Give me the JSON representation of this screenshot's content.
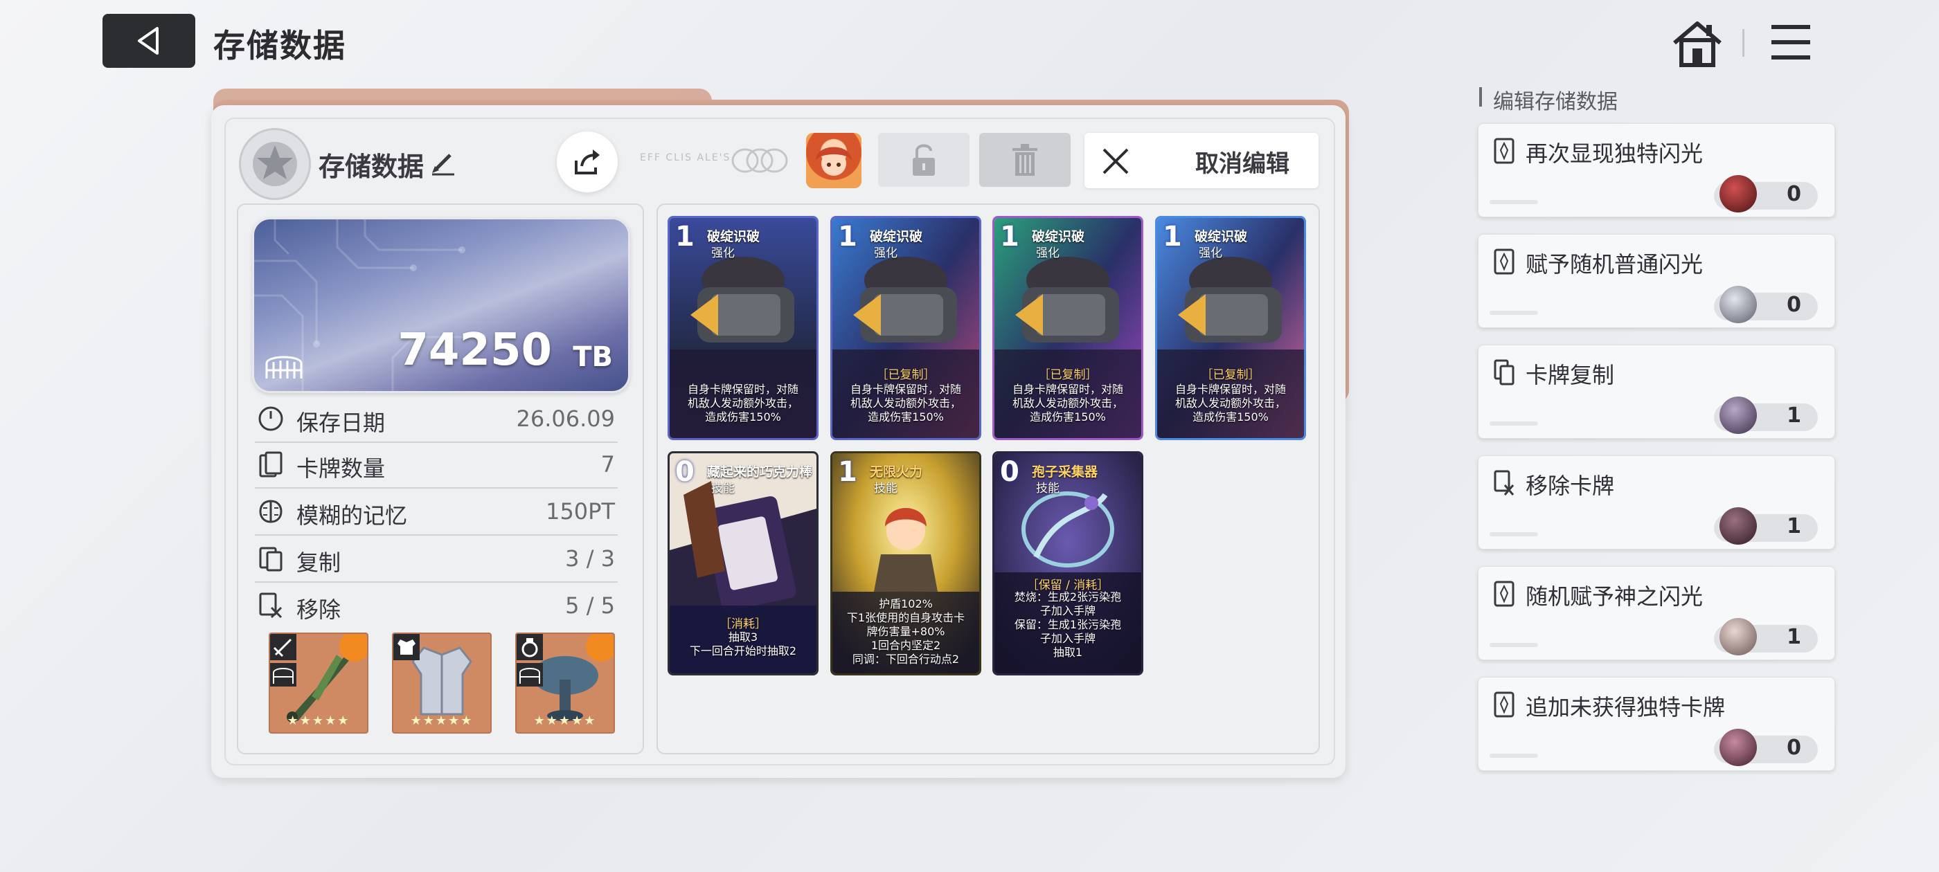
{
  "header": {
    "title": "存储数据"
  },
  "save": {
    "name": "存储数据",
    "deco_text": "EFF CLIS ALE'S."
  },
  "toolbar": {
    "cancel_label": "取消编辑"
  },
  "storage": {
    "value": "74250",
    "unit": "TB"
  },
  "stats": [
    {
      "label": "保存日期",
      "value": "26.06.09",
      "icon": "clock-icon"
    },
    {
      "label": "卡牌数量",
      "value": "7",
      "icon": "card-count-icon"
    },
    {
      "label": "模糊的记忆",
      "value": "150PT",
      "icon": "brain-icon"
    },
    {
      "label": "复制",
      "value": "3 / 3",
      "icon": "copy-card-icon"
    },
    {
      "label": "移除",
      "value": "5 / 5",
      "icon": "remove-card-icon"
    }
  ],
  "equipment": [
    {
      "slot": "weapon",
      "stars": "★★★★★",
      "icon": "sword-icon"
    },
    {
      "slot": "armor",
      "stars": "★★★★★",
      "icon": "armor-icon"
    },
    {
      "slot": "accessory",
      "stars": "★★★★★",
      "icon": "ring-icon"
    }
  ],
  "deck": [
    {
      "cost": "1",
      "name": "破绽识破",
      "type": "强化",
      "tag": "",
      "desc": [
        "自身卡牌保留时，对随",
        "机敌人发动额外攻击，",
        "造成伤害150%"
      ]
    },
    {
      "cost": "1",
      "name": "破绽识破",
      "type": "强化",
      "tag": "［已复制］",
      "desc": [
        "自身卡牌保留时，对随",
        "机敌人发动额外攻击，",
        "造成伤害150%"
      ]
    },
    {
      "cost": "1",
      "name": "破绽识破",
      "type": "强化",
      "tag": "［已复制］",
      "desc": [
        "自身卡牌保留时，对随",
        "机敌人发动额外攻击，",
        "造成伤害150%"
      ]
    },
    {
      "cost": "1",
      "name": "破绽识破",
      "type": "强化",
      "tag": "［已复制］",
      "desc": [
        "自身卡牌保留时，对随",
        "机敌人发动额外攻击，",
        "造成伤害150%"
      ]
    },
    {
      "cost": "0",
      "name": "藏起来的巧克力棒",
      "type": "技能",
      "tag": "［消耗］",
      "desc": [
        "抽取3",
        "下一回合开始时抽取2"
      ]
    },
    {
      "cost": "1",
      "name": "无限火力",
      "type": "技能",
      "tag": "",
      "desc": [
        "护盾102%",
        "下1张使用的自身攻击卡",
        "牌伤害量+80%",
        "1回合内坚定2",
        "同调：下回合行动点2"
      ]
    },
    {
      "cost": "0",
      "name": "孢子采集器",
      "type": "技能",
      "tag": "［保留 / 消耗］",
      "desc": [
        "焚烧：生成2张污染孢",
        "子加入手牌",
        "保留：生成1张污染孢",
        "子加入手牌",
        "抽取1"
      ]
    }
  ],
  "sidebar": {
    "title": "编辑存储数据",
    "options": [
      {
        "label": "再次显现独特闪光",
        "count": "0",
        "orb": "#8a2a2a"
      },
      {
        "label": "赋予随机普通闪光",
        "count": "0",
        "orb": "#8a8e98"
      },
      {
        "label": "卡牌复制",
        "count": "1",
        "orb": "#6a5a78"
      },
      {
        "label": "移除卡牌",
        "count": "1",
        "orb": "#5e4048"
      },
      {
        "label": "随机赋予神之闪光",
        "count": "1",
        "orb": "#a08a86"
      },
      {
        "label": "追加未获得独特卡牌",
        "count": "0",
        "orb": "#7a4a5e"
      }
    ]
  }
}
